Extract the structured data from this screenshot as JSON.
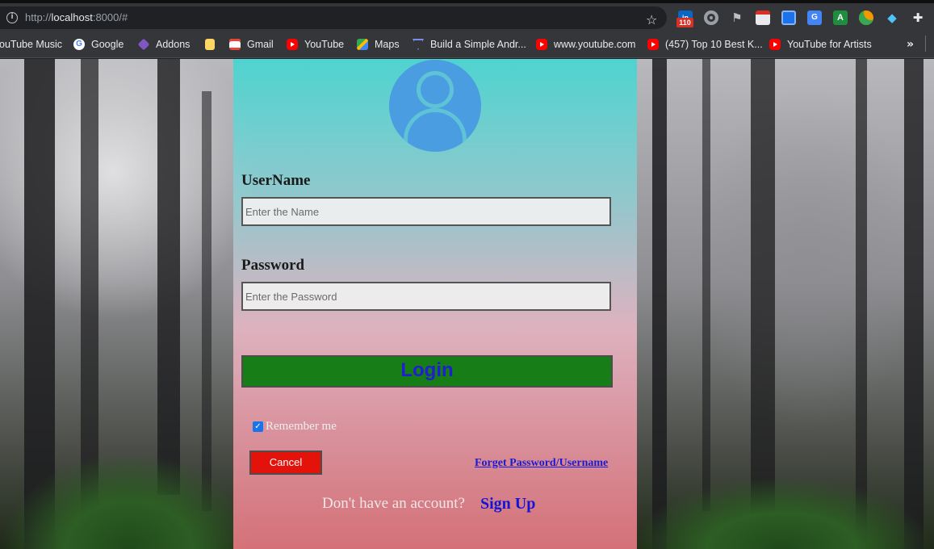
{
  "browser": {
    "url_scheme": "http://",
    "url_host": "localhost",
    "url_rest": ":8000/#",
    "extensions": [
      {
        "icon": "linkedin-icon",
        "label": "in",
        "badge": "110"
      },
      {
        "icon": "record-circle-icon"
      },
      {
        "icon": "flag-icon"
      },
      {
        "icon": "printer-icon"
      },
      {
        "icon": "reader-icon"
      },
      {
        "icon": "translate-icon",
        "label": "G"
      },
      {
        "icon": "a-letter-icon",
        "label": "A"
      },
      {
        "icon": "person-icon"
      },
      {
        "icon": "gem-icon"
      },
      {
        "icon": "puzzle-icon"
      }
    ],
    "bookmarks": [
      {
        "label": "ouTube Music",
        "icon": "none"
      },
      {
        "label": "Google",
        "icon": "google-icon"
      },
      {
        "label": "Addons",
        "icon": "addons-icon"
      },
      {
        "label": "",
        "icon": "folder-icon"
      },
      {
        "label": "Gmail",
        "icon": "gmail-icon"
      },
      {
        "label": "YouTube",
        "icon": "youtube-icon"
      },
      {
        "label": "Maps",
        "icon": "maps-icon"
      },
      {
        "label": "Build a Simple Andr...",
        "icon": "triangle-icon"
      },
      {
        "label": "www.youtube.com",
        "icon": "youtube-icon"
      },
      {
        "label": "(457) Top 10 Best K...",
        "icon": "youtube-icon"
      },
      {
        "label": "YouTube for Artists",
        "icon": "youtube-icon"
      }
    ],
    "overflow_glyph": "»"
  },
  "login": {
    "username_label": "UserName",
    "username_placeholder": "Enter the Name",
    "password_label": "Password",
    "password_placeholder": "Enter the Password",
    "login_button": "Login",
    "remember_label": "Remember me",
    "remember_checked": true,
    "cancel_button": "Cancel",
    "forget_link": "Forget Password/Username",
    "no_account_text": "Don't have an account?",
    "signup_link": "Sign Up"
  },
  "colors": {
    "login_button_bg": "#177d17",
    "login_button_text": "#1f1fd0",
    "cancel_button_bg": "#e3120b",
    "link_color": "#1a1ad6"
  }
}
